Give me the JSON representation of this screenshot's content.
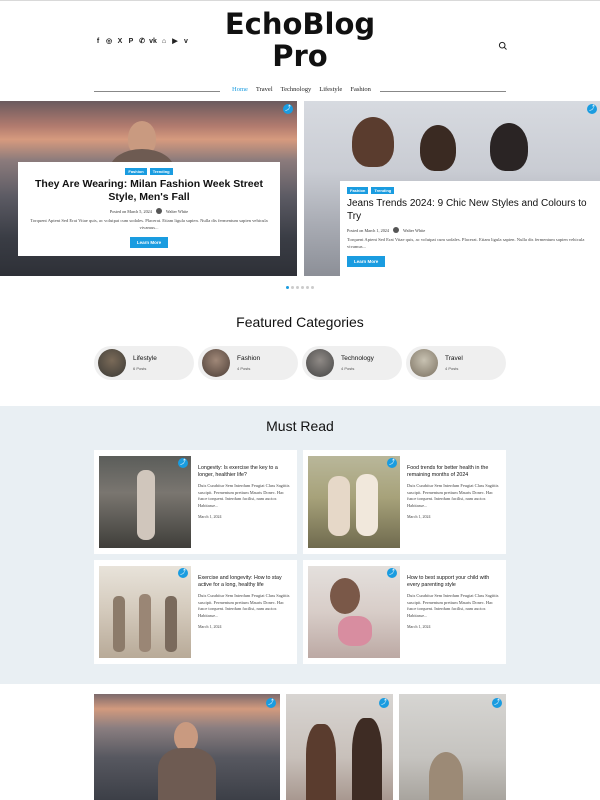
{
  "site": {
    "logo_line1": "EchoBlog",
    "logo_line2": "Pro",
    "socials": [
      "facebook-icon",
      "instagram-icon",
      "x-icon",
      "pinterest-icon",
      "whatsapp-icon",
      "vk-icon",
      "twitch-icon",
      "youtube-icon",
      "vimeo-icon"
    ],
    "social_glyphs": [
      "f",
      "◎",
      "X",
      "P",
      "✆",
      "vk",
      "⌂",
      "▶",
      "v"
    ]
  },
  "nav": {
    "items": [
      {
        "label": "Home",
        "active": true
      },
      {
        "label": "Travel",
        "active": false
      },
      {
        "label": "Technology",
        "active": false
      },
      {
        "label": "Lifestyle",
        "active": false
      },
      {
        "label": "Fashion",
        "active": false
      }
    ]
  },
  "slider": {
    "slides": [
      {
        "tags": [
          "Fashion",
          "Trending"
        ],
        "title": "They Are Wearing: Milan Fashion Week Street Style, Men's Fall",
        "date": "Posted on March 5, 2024",
        "author": "Walter White",
        "excerpt": "Torquent Aptent Sed Erat Vitae quis, ac volutpat cum sodales. Placerat. Etiam ligula sapien. Nulla dis fermentum sapien vehicula vivamus...",
        "button": "Learn More"
      },
      {
        "tags": [
          "Fashion",
          "Trending"
        ],
        "title": "Jeans Trends 2024: 9 Chic New Styles and Colours to Try",
        "date": "Posted on March 1, 2024",
        "author": "Walter White",
        "excerpt": "Torquent Aptent Sed Erat Vitae quis, ac volutpat cum sodales. Placerat. Etiam ligula sapien. Nulla dis fermentum sapien vehicula vivamus...",
        "button": "Learn More"
      }
    ],
    "dot_count": 6,
    "active_dot": 0
  },
  "featured": {
    "title": "Featured Categories",
    "categories": [
      {
        "name": "Lifestyle",
        "count": "6 Posts"
      },
      {
        "name": "Fashion",
        "count": "4 Posts"
      },
      {
        "name": "Technology",
        "count": "4 Posts"
      },
      {
        "name": "Travel",
        "count": "4 Posts"
      }
    ]
  },
  "must_read": {
    "title": "Must Read",
    "posts": [
      {
        "title": "Longevity: Is exercise the key to a longer, healthier life?",
        "excerpt": "Duis Curabitur Sem Interdum Feugiat Class Sagittis suscipit. Fermentum pretium Mauris Donec. Hac fusce torquent. Interdum facilisi, nam auctor. Habitasse...",
        "date": "March 1, 2024"
      },
      {
        "title": "Food trends for better health in the remaining months of 2024",
        "excerpt": "Duis Curabitur Sem Interdum Feugiat Class Sagittis suscipit. Fermentum pretium Mauris Donec. Hac fusce torquent. Interdum facilisi, nam auctor. Habitasse...",
        "date": "March 1, 2024"
      },
      {
        "title": "Exercise and longevity: How to stay active for a long, healthy life",
        "excerpt": "Duis Curabitur Sem Interdum Feugiat Class Sagittis suscipit. Fermentum pretium Mauris Donec. Hac fusce torquent. Interdum facilisi, nam auctor. Habitasse...",
        "date": "March 1, 2024"
      },
      {
        "title": "How to best support your child with every parenting style",
        "excerpt": "Duis Curabitur Sem Interdum Feugiat Class Sagittis suscipit. Fermentum pretium Mauris Donec. Hac fusce torquent. Interdum facilisi, nam auctor. Habitasse...",
        "date": "March 1, 2024"
      }
    ]
  },
  "colors": {
    "accent": "#1a9ce0",
    "must_read_bg": "#e9eff3",
    "pill_bg": "#efefef"
  }
}
